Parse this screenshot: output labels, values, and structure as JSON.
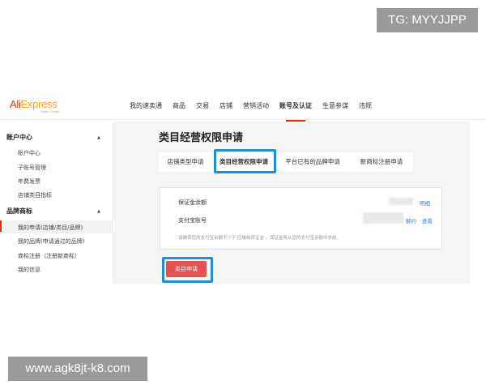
{
  "watermarks": {
    "tg": "TG: MYYJJPP",
    "url": "www.agk8jt-k8.com"
  },
  "header": {
    "logo_part1": "Ali",
    "logo_part2": "Express",
    "logo_sub": "Seller Center",
    "nav": [
      {
        "label": "我的速卖通",
        "active": false
      },
      {
        "label": "商品",
        "active": false
      },
      {
        "label": "交易",
        "active": false
      },
      {
        "label": "店铺",
        "active": false
      },
      {
        "label": "营销活动",
        "active": false
      },
      {
        "label": "账号及认证",
        "active": true
      },
      {
        "label": "生意参谋",
        "active": false
      },
      {
        "label": "违规",
        "active": false
      }
    ]
  },
  "sidebar": {
    "sections": [
      {
        "title": "账户中心",
        "arrow": "▲",
        "items": [
          {
            "label": "账户中心"
          },
          {
            "label": "子账号管理"
          },
          {
            "label": "年费发票"
          },
          {
            "label": "店铺类目指标"
          }
        ]
      },
      {
        "title": "品牌商标",
        "arrow": "▲",
        "items": [
          {
            "label": "我的申请(店铺/类目/品牌)",
            "active": true
          },
          {
            "label": "我的品牌(申请通过的品牌)"
          },
          {
            "label": "商标注册（注册新商标）"
          },
          {
            "label": "我的信息"
          }
        ]
      }
    ]
  },
  "main": {
    "title": "类目经营权限申请",
    "tabs": [
      {
        "label": "店铺类型申请"
      },
      {
        "label": "类目经营权限申请",
        "active": true
      },
      {
        "label": "平台已有的品牌申请"
      },
      {
        "label": "新商标注册申请"
      }
    ],
    "card": {
      "deposit_label": "保证金余额",
      "deposit_link": "明细",
      "alipay_label": "支付宝账号",
      "alipay_link1": "解约",
      "alipay_link2": "查看",
      "note": "请确保您的支付宝余额不少于'应缴纳保证金'。保证金将从您的支付宝余额中冻结。"
    },
    "apply_button": "类目申请"
  },
  "colors": {
    "accent": "#e62e04",
    "highlight": "#1e90d8",
    "button": "#e55050",
    "link": "#3b7fd3"
  }
}
